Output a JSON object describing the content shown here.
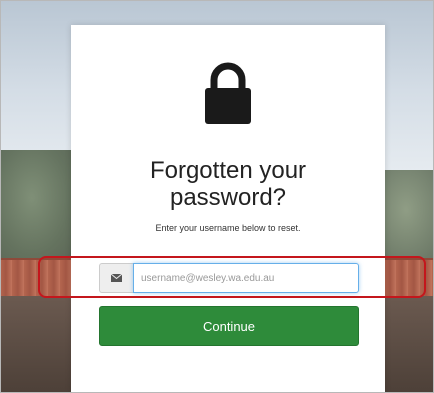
{
  "page": {
    "title_line1": "Forgotten your",
    "title_line2": "password?",
    "subtitle": "Enter your username below to reset."
  },
  "form": {
    "email_icon": "envelope-icon",
    "username_placeholder": "username@wesley.wa.edu.au",
    "username_value": "",
    "continue_label": "Continue"
  },
  "icons": {
    "lock": "lock-icon"
  },
  "colors": {
    "continue_button": "#2e8b3a",
    "highlight_outline": "#c4161c",
    "input_focus": "#66afe9"
  }
}
